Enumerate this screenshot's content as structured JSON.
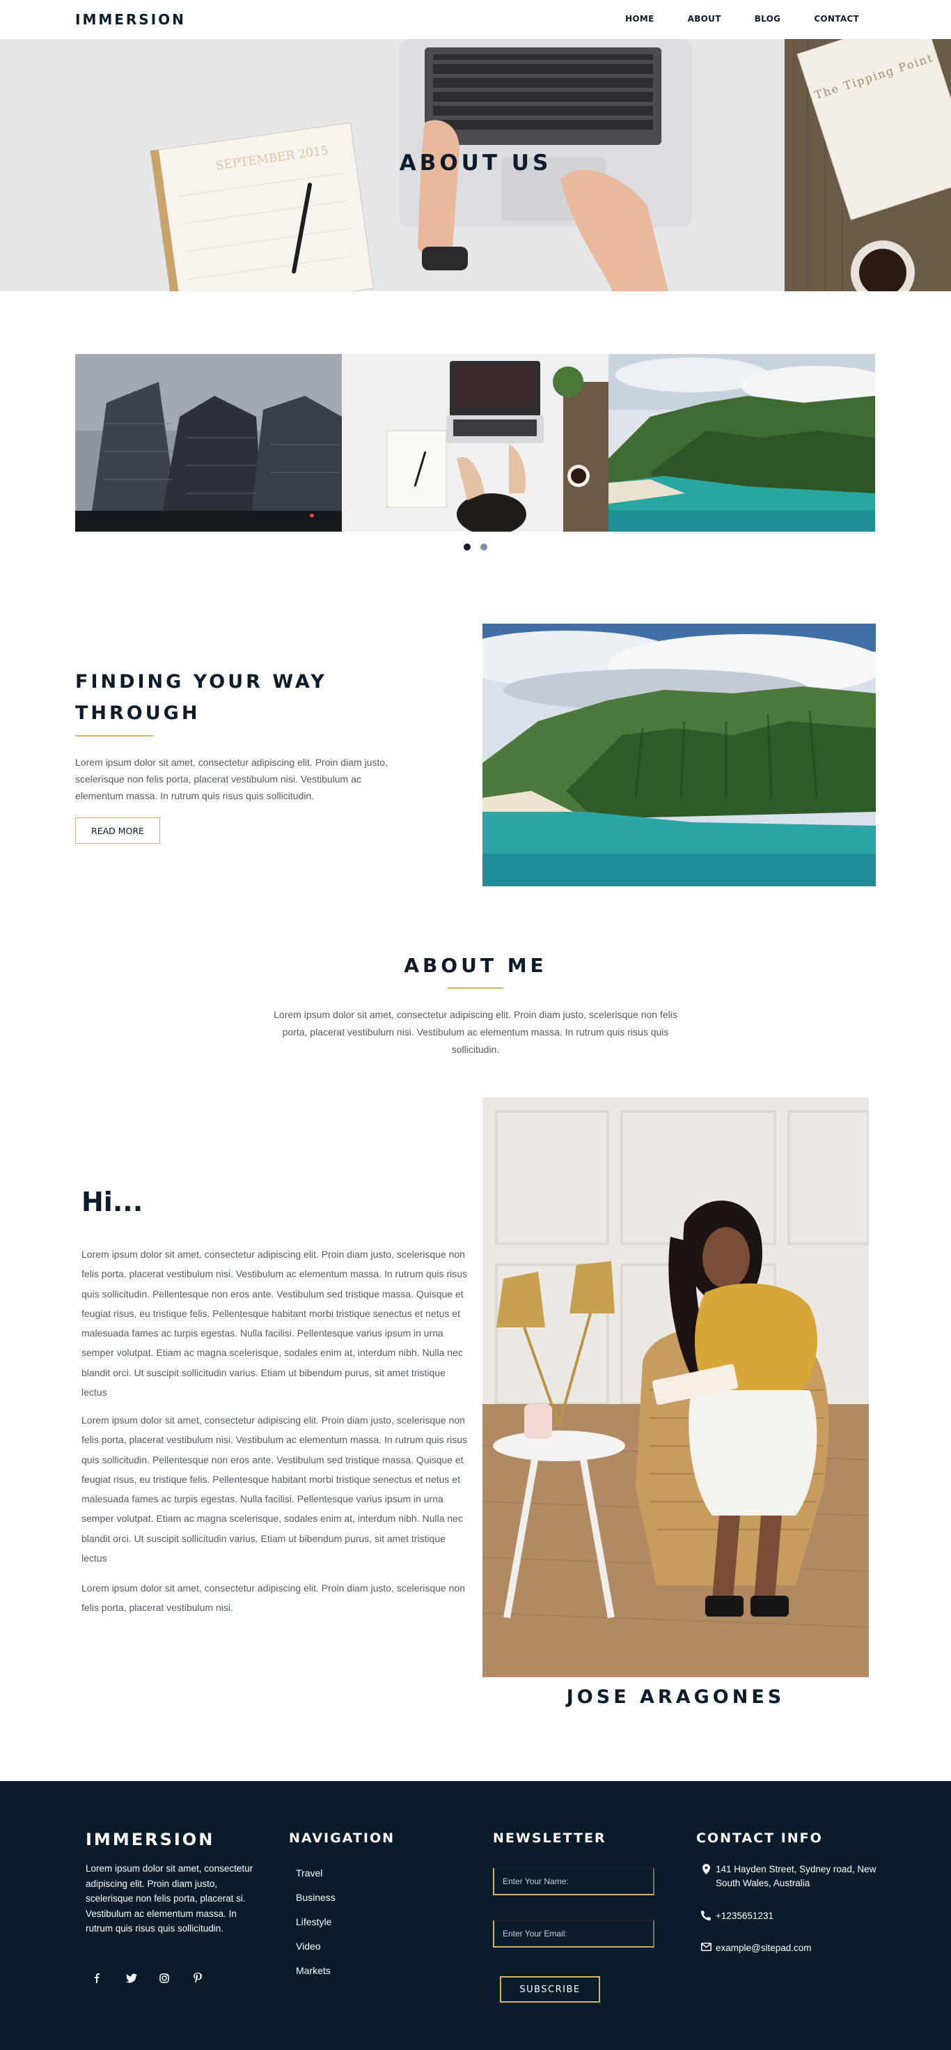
{
  "header": {
    "logo": "IMMERSION",
    "nav": [
      "HOME",
      "ABOUT",
      "BLOG",
      "CONTACT"
    ]
  },
  "hero": {
    "title": "ABOUT US",
    "calendar_text": "SEPTEMBER 2015",
    "book_text": "The Tipping Point"
  },
  "slider": {
    "slides": [
      "city-skyscrapers-photo",
      "desk-laptop-photo",
      "coastal-mountains-photo"
    ],
    "active_index": 0,
    "dot_count": 2
  },
  "feature": {
    "title_line1": "FINDING YOUR WAY",
    "title_line2": "THROUGH",
    "text": "Lorem ipsum dolor sit amet, consectetur adipiscing elit. Proin diam justo, scelerisque non felis porta, placerat vestibulum nisi. Vestibulum ac elementum massa. In rutrum quis risus quis sollicitudin.",
    "button": "READ MORE"
  },
  "about_me": {
    "title": "ABOUT ME",
    "text": "Lorem ipsum dolor sit amet, consectetur adipiscing elit. Proin diam justo, scelerisque non felis porta, placerat vestibulum nisi. Vestibulum ac elementum massa. In rutrum quis risus quis sollicitudin."
  },
  "profile": {
    "greeting": "Hi...",
    "paragraphs": [
      "Lorem ipsum dolor sit amet, consectetur adipiscing elit. Proin diam justo, scelerisque non felis porta, placerat vestibulum nisi. Vestibulum ac elementum massa. In rutrum quis risus quis sollicitudin. Pellentesque non eros ante. Vestibulum sed tristique massa. Quisque et feugiat risus, eu tristique felis. Pellentesque habitant morbi tristique senectus et netus et malesuada fames ac turpis egestas. Nulla facilisi. Pellentesque varius ipsum in urna semper volutpat. Etiam ac magna scelerisque, sodales enim at, interdum nibh. Nulla nec blandit orci. Ut suscipit sollicitudin varius. Etiam ut bibendum purus, sit amet tristique lectus",
      "Lorem ipsum dolor sit amet, consectetur adipiscing elit. Proin diam justo, scelerisque non felis porta, placerat vestibulum nisi. Vestibulum ac elementum massa. In rutrum quis risus quis sollicitudin. Pellentesque non eros ante. Vestibulum sed tristique massa. Quisque et feugiat risus, eu tristique felis. Pellentesque habitant morbi tristique senectus et netus et malesuada fames ac turpis egestas. Nulla facilisi. Pellentesque varius ipsum in urna semper volutpat. Etiam ac magna scelerisque, sodales enim at, interdum nibh. Nulla nec blandit orci. Ut suscipit sollicitudin varius. Etiam ut bibendum purus, sit amet tristique lectus",
      "Lorem ipsum dolor sit amet, consectetur adipiscing elit. Proin diam justo, scelerisque non felis porta, placerat vestibulum nisi."
    ],
    "name": "JOSE ARAGONES"
  },
  "footer": {
    "logo": "IMMERSION",
    "about": "Lorem ipsum dolor sit amet, consectetur adipiscing elit. Proin diam justo, scelerisque non felis porta, placerat si. Vestibulum ac elementum massa. In rutrum quis risus quis sollicitudin.",
    "social": [
      "facebook-icon",
      "twitter-icon",
      "instagram-icon",
      "pinterest-icon"
    ],
    "navigation_title": "NAVIGATION",
    "navigation": [
      "Travel",
      "Business",
      "Lifestyle",
      "Video",
      "Markets"
    ],
    "newsletter_title": "NEWSLETTER",
    "name_placeholder": "Enter Your Name:",
    "email_placeholder": "Enter Your Email:",
    "subscribe": "SUBSCRIBE",
    "contact_title": "CONTACT INFO",
    "address": "141 Hayden Street, Sydney road, New South Wales, Australia",
    "phone": "+1235651231",
    "email": "example@sitepad.com"
  },
  "colors": {
    "navy": "#0a1b2c",
    "gold": "#d9b26a",
    "body_text": "#555b63"
  }
}
